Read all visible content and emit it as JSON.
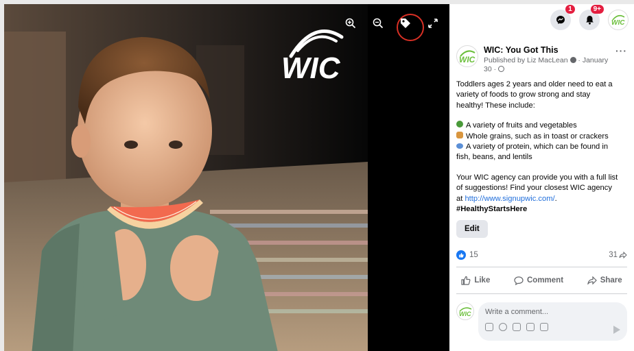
{
  "photo": {
    "watermark_text": "WIC",
    "tools": [
      {
        "name": "zoom-in-icon"
      },
      {
        "name": "zoom-out-icon"
      },
      {
        "name": "tag-icon"
      },
      {
        "name": "fullscreen-icon"
      }
    ]
  },
  "topbar": {
    "messenger_badge": "1",
    "notifications_badge": "9+"
  },
  "post": {
    "page_name": "WIC: You Got This",
    "meta_line1": "Published by Liz MacLean",
    "meta_date": "January",
    "meta_line2": "30 ·",
    "body": {
      "p1_l1": "Toddlers ages 2 years and older need to eat a",
      "p1_l2": "variety of foods to grow strong and stay",
      "p1_l3": "healthy! These include:",
      "item1": "A variety of fruits and vegetables",
      "item2": "Whole grains, such as in toast or crackers",
      "item3_l1": "A variety of protein, which can be found in",
      "item3_l2": "fish, beans, and lentils",
      "p3_l1": "Your WIC agency can provide you with a full list",
      "p3_l2": "of suggestions! Find your closest WIC agency",
      "p3_l3_prefix": "at ",
      "link": "http://www.signupwic.com/",
      "p3_l3_suffix": ".",
      "hashtag": "#HealthyStartsHere"
    },
    "edit_label": "Edit",
    "reactions_count": "15",
    "shares_count": "31",
    "actions": {
      "like": "Like",
      "comment": "Comment",
      "share": "Share"
    },
    "comment_placeholder": "Write a comment..."
  },
  "colors": {
    "accent_blue": "#1877f2",
    "highlight_red": "#d93025",
    "badge_red": "#e41e3f"
  }
}
